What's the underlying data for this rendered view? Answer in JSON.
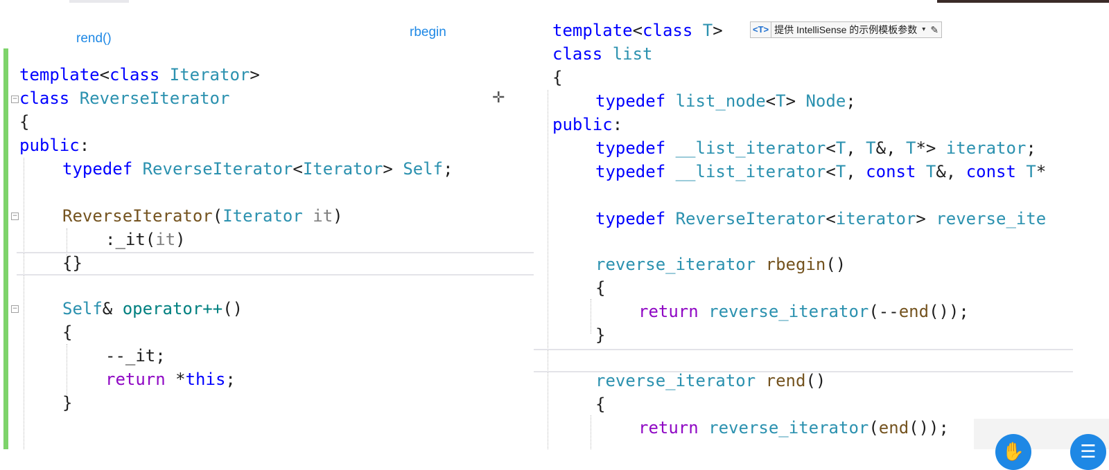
{
  "annotations": {
    "rend": "rend()",
    "rbegin": "rbegin"
  },
  "left_code": {
    "l1": {
      "a": "template",
      "b": "<",
      "c": "class",
      "d": " ",
      "e": "Iterator",
      "f": ">"
    },
    "l2": {
      "a": "class",
      "b": " ",
      "c": "ReverseIterator"
    },
    "l3": "{",
    "l4": {
      "a": "public",
      "b": ":"
    },
    "l5": {
      "a": "typedef",
      "b": " ",
      "c": "ReverseIterator",
      "d": "<",
      "e": "Iterator",
      "f": ">",
      "g": " ",
      "h": "Self",
      "i": ";"
    },
    "l6": {
      "a": "ReverseIterator",
      "b": "(",
      "c": "Iterator",
      "d": " ",
      "e": "it",
      "f": ")"
    },
    "l7": {
      "a": ":_it(",
      "b": "it",
      "c": ")"
    },
    "l8": "{}",
    "l9": {
      "a": "Self",
      "b": "& ",
      "c": "operator++",
      "d": "()"
    },
    "l10": "{",
    "l11": "--_it;",
    "l12": {
      "a": "return",
      "b": " *",
      "c": "this",
      "d": ";"
    },
    "l13": "}"
  },
  "right_code": {
    "r1": {
      "a": "template",
      "b": "<",
      "c": "class",
      "d": " ",
      "e": "T",
      "f": ">"
    },
    "r2": {
      "a": "class",
      "b": " ",
      "c": "list"
    },
    "r3": "{",
    "r4": {
      "a": "typedef",
      "b": " ",
      "c": "list_node",
      "d": "<",
      "e": "T",
      "f": "> ",
      "g": "Node",
      "h": ";"
    },
    "r5": {
      "a": "public",
      "b": ":"
    },
    "r6": {
      "a": "typedef",
      "b": " ",
      "c": "__list_iterator",
      "d": "<",
      "e": "T",
      "f": ", ",
      "g": "T",
      "h": "&, ",
      "i": "T",
      "j": "*> ",
      "k": "iterator",
      "l": ";"
    },
    "r7": {
      "a": "typedef",
      "b": " ",
      "c": "__list_iterator",
      "d": "<",
      "e": "T",
      "f": ", ",
      "g": "const",
      "h": " ",
      "i": "T",
      "j": "&, ",
      "k": "const",
      "l": " ",
      "m": "T",
      "n": "*"
    },
    "r8": {
      "a": "typedef",
      "b": " ",
      "c": "ReverseIterator",
      "d": "<",
      "e": "iterator",
      "f": "> ",
      "g": "reverse_ite"
    },
    "r9": {
      "a": "reverse_iterator",
      "b": " ",
      "c": "rbegin",
      "d": "()"
    },
    "r10": "{",
    "r11": {
      "a": "return",
      "b": " ",
      "c": "reverse_iterator",
      "d": "(--",
      "e": "end",
      "f": "());"
    },
    "r12": "}",
    "r13": {
      "a": "reverse_iterator",
      "b": " ",
      "c": "rend",
      "d": "()"
    },
    "r14": "{",
    "r15": {
      "a": "return",
      "b": " ",
      "c": "reverse_iterator",
      "d": "(",
      "e": "end",
      "f": "());"
    }
  },
  "intellisense": {
    "tag": "<T>",
    "text": "提供 IntelliSense 的示例模板参数",
    "dropdown": "▾",
    "edit": "✎"
  },
  "icons": {
    "fold": "minus-box",
    "cursor": "crosshair-move",
    "hand": "raise-hand",
    "chat": "chat"
  },
  "colors": {
    "keyword": "#0000ff",
    "type": "#2b91af",
    "function": "#74531f",
    "control": "#8f08c4",
    "accent_bar": "#7ed36b",
    "annotation": "#1e88e5"
  }
}
